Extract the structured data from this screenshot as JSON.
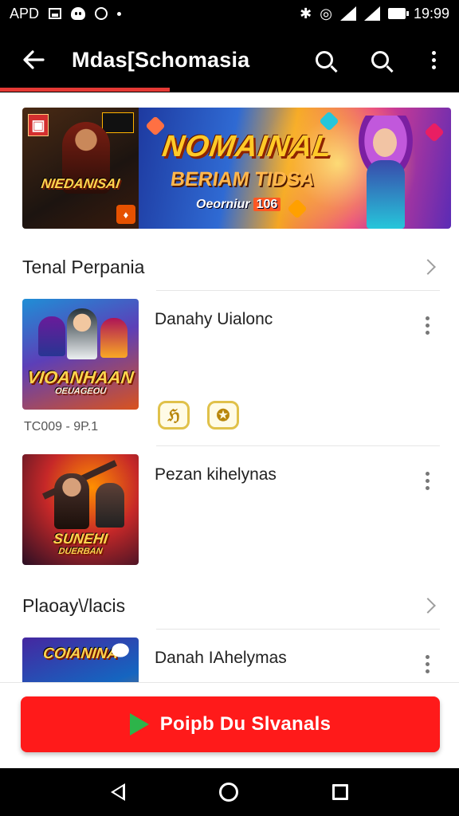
{
  "status_bar": {
    "carrier": "APD",
    "time": "19:99"
  },
  "app_bar": {
    "title": "Mdas[Schomasia"
  },
  "banner": {
    "left_title": "NIEDANISAI",
    "right_title": "NOMAINAL",
    "right_subtitle": "BERIAM TIDSA",
    "right_date_label": "Oeorniur",
    "right_date_value": "106"
  },
  "sections": [
    {
      "title": "Tenal Perpania",
      "items": [
        {
          "title": "Danahy Uialonc",
          "thumb_text": "VIOANHAAN",
          "thumb_subtext": "OEUAGEOU",
          "meta": "TC009 - 9P.1"
        },
        {
          "title": "Pezan kihelynas",
          "thumb_text": "SUNEHI",
          "thumb_subtext": "DUERBAN"
        }
      ]
    },
    {
      "title": "Plaoay\\/lacis",
      "items": [
        {
          "title": "Danah IAhelymas",
          "thumb_text": "COIANINA"
        }
      ]
    }
  ],
  "cta": {
    "label": "Poipb Du Slvanals",
    "play_color": "#2db44a",
    "background": "#ff1a1a"
  },
  "colors": {
    "accent": "#e53935"
  }
}
